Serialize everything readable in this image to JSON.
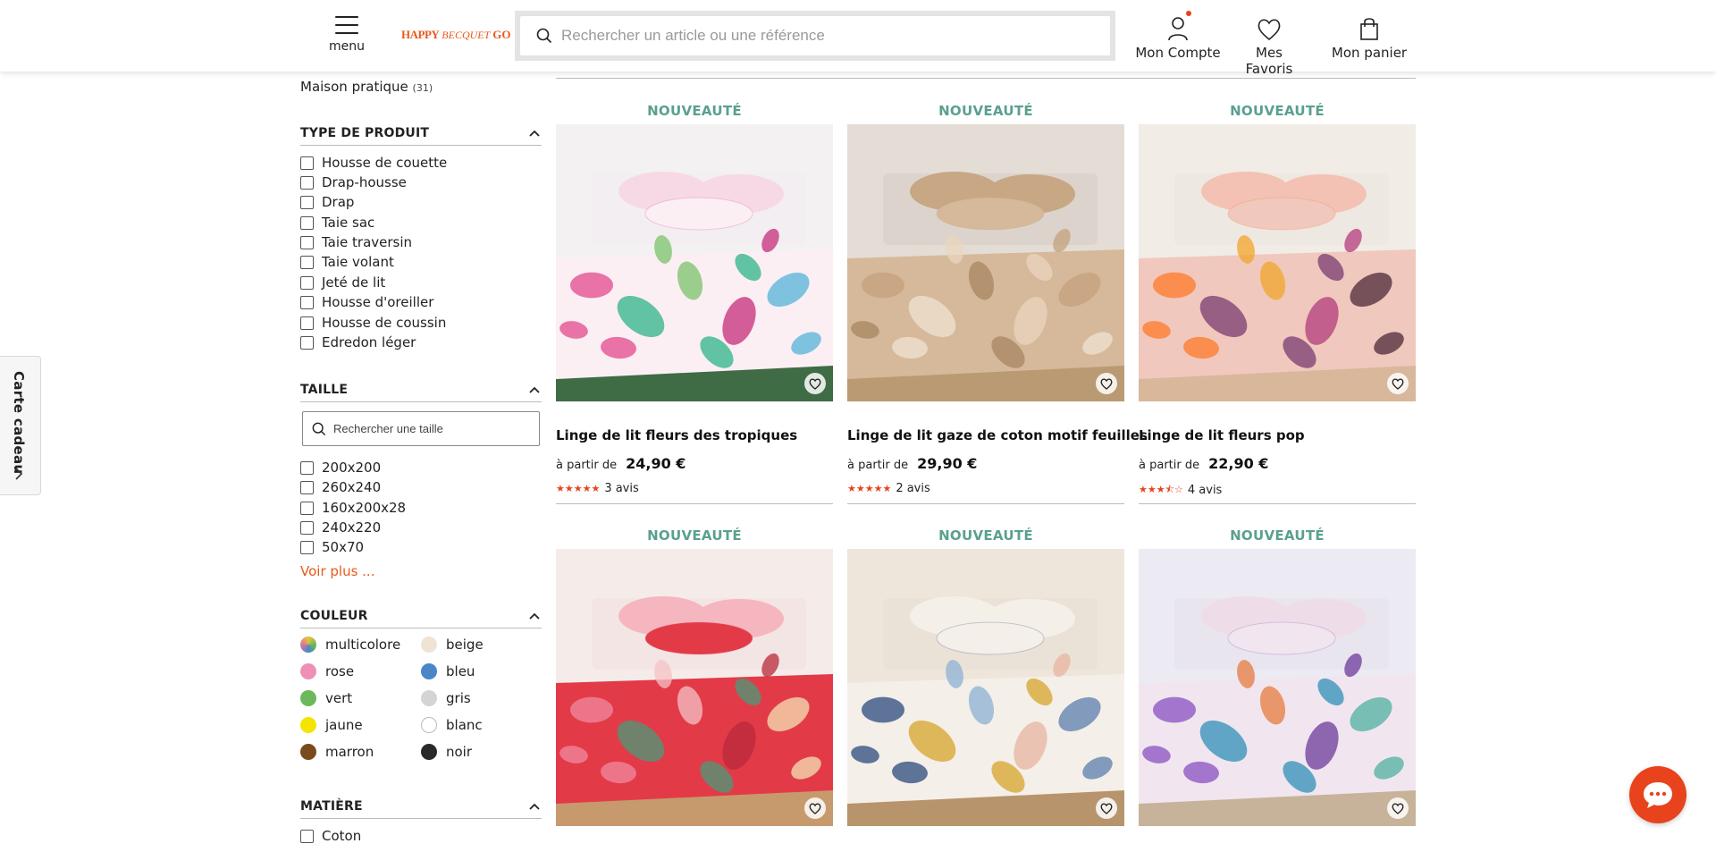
{
  "header": {
    "menu_label": "menu",
    "logo": {
      "part1": "HAPPY",
      "part2": "BECQUET",
      "part3": "GO"
    },
    "search_placeholder": "Rechercher un article ou une référence",
    "account_label": "Mon Compte",
    "favorites_label": "Mes Favoris",
    "cart_label": "Mon panier",
    "accent_color": "#e8431c"
  },
  "gift_tab": {
    "label": "Carte cadeau"
  },
  "sidebar": {
    "category": {
      "label": "Maison pratique",
      "count": "(31)"
    },
    "product_type": {
      "title": "TYPE DE PRODUIT",
      "options": [
        "Housse de couette",
        "Drap-housse",
        "Drap",
        "Taie sac",
        "Taie traversin",
        "Taie volant",
        "Jeté de lit",
        "Housse d'oreiller",
        "Housse de coussin",
        "Edredon léger"
      ]
    },
    "size": {
      "title": "TAILLE",
      "search_placeholder": "Rechercher une taille",
      "options": [
        "200x200",
        "260x240",
        "160x200x28",
        "240x220",
        "50x70"
      ],
      "more_label": "Voir plus ..."
    },
    "color": {
      "title": "COULEUR",
      "options": [
        {
          "label": "multicolore",
          "color": "multi"
        },
        {
          "label": "beige",
          "color": "#efe3d6"
        },
        {
          "label": "rose",
          "color": "#ef8fb8"
        },
        {
          "label": "bleu",
          "color": "#4a86c8"
        },
        {
          "label": "vert",
          "color": "#6cb85a"
        },
        {
          "label": "gris",
          "color": "#d4d4d4"
        },
        {
          "label": "jaune",
          "color": "#f5e400"
        },
        {
          "label": "blanc",
          "color": "#ffffff"
        },
        {
          "label": "marron",
          "color": "#7a4a1e"
        },
        {
          "label": "noir",
          "color": "#2a2a2a"
        }
      ]
    },
    "material": {
      "title": "MATIÈRE",
      "options": [
        "Coton"
      ]
    }
  },
  "products": [
    {
      "badge": "NOUVEAUTÉ",
      "name": "Linge de lit fleurs des tropiques",
      "from": "à partir de",
      "price": "24,90 €",
      "rating": 5,
      "reviews": "3 avis",
      "image": "tropical-floral-bedding"
    },
    {
      "badge": "NOUVEAUTÉ",
      "name": "Linge de lit gaze de coton motif feuilles",
      "from": "à partir de",
      "price": "29,90 €",
      "rating": 5,
      "reviews": "2 avis",
      "image": "beige-leaf-bedding"
    },
    {
      "badge": "NOUVEAUTÉ",
      "name": "Linge de lit fleurs pop",
      "from": "à partir de",
      "price": "22,90 €",
      "rating": 3.5,
      "reviews": "4 avis",
      "image": "pop-flower-bedding"
    },
    {
      "badge": "NOUVEAUTÉ",
      "image": "red-patterned-bedding"
    },
    {
      "badge": "NOUVEAUTÉ",
      "image": "blue-yellow-leaf-bedding"
    },
    {
      "badge": "NOUVEAUTÉ",
      "image": "watercolor-flower-bedding"
    }
  ]
}
